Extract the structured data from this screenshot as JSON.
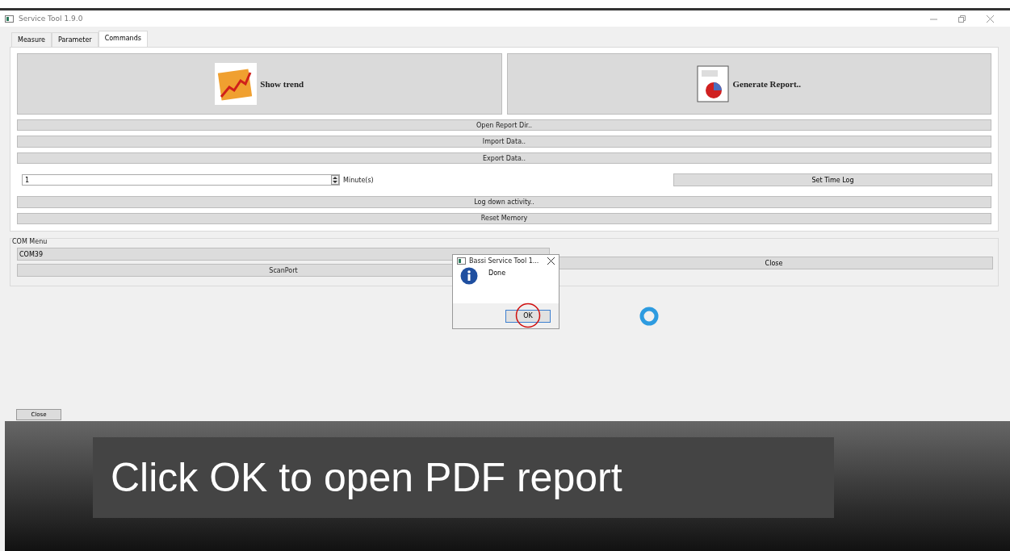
{
  "window": {
    "title": "Service Tool 1.9.0"
  },
  "tabs": [
    {
      "label": "Measure",
      "selected": false
    },
    {
      "label": "Parameter",
      "selected": false
    },
    {
      "label": "Commands",
      "selected": true
    }
  ],
  "big_buttons": [
    {
      "label": "Show trend",
      "kind": "trend"
    },
    {
      "label": "Generate Report..",
      "kind": "report"
    }
  ],
  "commands_top": [
    "Open Report Dir..",
    "Import Data..",
    "Export Data.."
  ],
  "time_log": {
    "value": "1",
    "unit": "Minute(s)",
    "button": "Set Time Log"
  },
  "commands_bottom": [
    "Log down activity..",
    "Reset Memory"
  ],
  "com_menu": {
    "title": "COM Menu",
    "port": "COM39",
    "scan_button": "ScanPort",
    "close_button": "Close"
  },
  "close_button": "Close",
  "dialog": {
    "title": "Bassi Service Tool 1...",
    "message": "Done",
    "ok_button": "OK"
  },
  "caption": "Click OK to open PDF report"
}
